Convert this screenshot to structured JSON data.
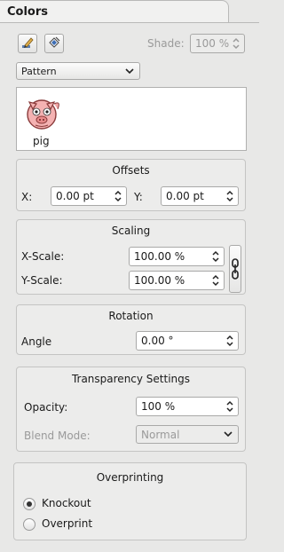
{
  "panel": {
    "title": "Colors"
  },
  "toolbar": {
    "edit_icon": "pen-edit-icon",
    "swatch_icon": "color-swatch-icon",
    "shade_label": "Shade:",
    "shade_value": "100 %"
  },
  "fill_type": {
    "selected": "Pattern"
  },
  "pattern_preview": {
    "name": "pig",
    "icon": "pig-icon"
  },
  "offsets": {
    "title": "Offsets",
    "x_label": "X:",
    "x_value": "0.00 pt",
    "y_label": "Y:",
    "y_value": "0.00 pt"
  },
  "scaling": {
    "title": "Scaling",
    "x_label": "X-Scale:",
    "x_value": "100.00 %",
    "y_label": "Y-Scale:",
    "y_value": "100.00 %",
    "link_icon": "chain-link-icon"
  },
  "rotation": {
    "title": "Rotation",
    "angle_label": "Angle",
    "angle_value": "0.00 °"
  },
  "transparency": {
    "title": "Transparency Settings",
    "opacity_label": "Opacity:",
    "opacity_value": "100 %",
    "blend_label": "Blend Mode:",
    "blend_value": "Normal"
  },
  "overprinting": {
    "title": "Overprinting",
    "knockout_label": "Knockout",
    "overprint_label": "Overprint",
    "selected": "Knockout"
  }
}
